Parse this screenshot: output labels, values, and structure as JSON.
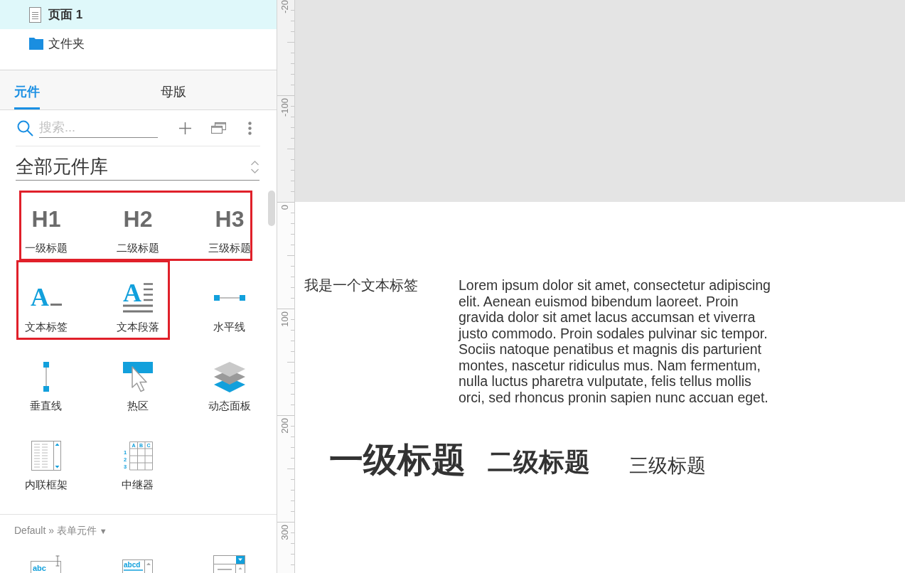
{
  "pages": [
    {
      "kind": "page",
      "label": "页面 1",
      "selected": true
    },
    {
      "kind": "folder",
      "label": "文件夹",
      "selected": false
    }
  ],
  "panel_tabs": [
    {
      "label": "元件",
      "selected": true
    },
    {
      "label": "母版",
      "selected": false
    }
  ],
  "search": {
    "placeholder": "搜索..."
  },
  "library": {
    "title": "全部元件库"
  },
  "widgets": [
    {
      "kind": "heading",
      "glyph": "H1",
      "label": "一级标题",
      "highlighted": true
    },
    {
      "kind": "heading",
      "glyph": "H2",
      "label": "二级标题",
      "highlighted": true
    },
    {
      "kind": "heading",
      "glyph": "H3",
      "label": "三级标题",
      "highlighted": true
    },
    {
      "kind": "text_label",
      "glyph": "A",
      "label": "文本标签",
      "highlighted": true
    },
    {
      "kind": "text_paragraph",
      "glyph": "A",
      "label": "文本段落",
      "highlighted": true
    },
    {
      "kind": "horizontal_line",
      "label": "水平线",
      "highlighted": false
    },
    {
      "kind": "vertical_line",
      "label": "垂直线",
      "highlighted": false
    },
    {
      "kind": "hotspot",
      "label": "热区",
      "highlighted": false
    },
    {
      "kind": "dynamic_panel",
      "label": "动态面板",
      "highlighted": false
    },
    {
      "kind": "inline_frame",
      "label": "内联框架",
      "highlighted": false
    },
    {
      "kind": "repeater",
      "column_marks": [
        "A",
        "B",
        "C"
      ],
      "row_marks": [
        "1",
        "2",
        "3"
      ],
      "label": "中继器",
      "highlighted": false
    }
  ],
  "form_library": {
    "title": "Default » 表单元件",
    "caret": "▼",
    "widgets": [
      {
        "kind": "text_field",
        "glyph": "abc"
      },
      {
        "kind": "text_area",
        "glyph": "abcd"
      },
      {
        "kind": "droplist"
      }
    ]
  },
  "ruler": {
    "labels": [
      "-20",
      "-100",
      "0",
      "100",
      "200",
      "300"
    ]
  },
  "canvas": {
    "items": [
      {
        "kind": "label",
        "text": "我是一个文本标签"
      },
      {
        "kind": "paragraph",
        "text": "Lorem ipsum dolor sit amet, consectetur adipiscing elit. Aenean euismod bibendum laoreet. Proin gravida dolor sit amet lacus accumsan et viverra justo commodo. Proin sodales pulvinar sic tempor. Sociis natoque penatibus et magnis dis parturient montes, nascetur ridiculus mus. Nam fermentum, nulla luctus pharetra vulputate, felis tellus mollis orci, sed rhoncus pronin sapien nunc accuan eget."
      },
      {
        "kind": "h1",
        "text": "一级标题"
      },
      {
        "kind": "h2",
        "text": "二级标题"
      },
      {
        "kind": "h3",
        "text": "三级标题"
      }
    ]
  }
}
